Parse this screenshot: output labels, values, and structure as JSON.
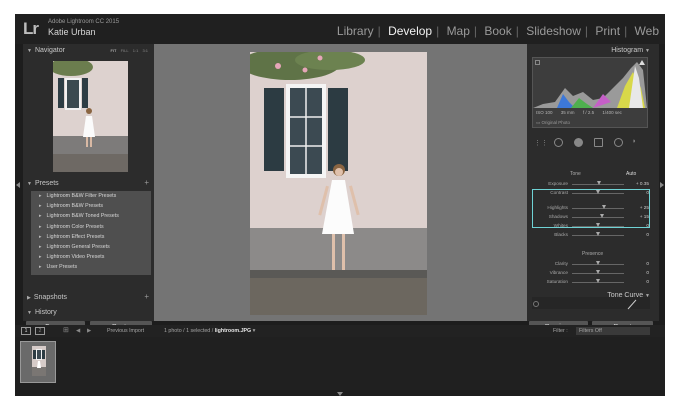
{
  "app": {
    "logo": "Lr",
    "product": "Adobe Lightroom CC 2015",
    "user": "Katie Urban"
  },
  "modules": [
    {
      "label": "Library",
      "active": false
    },
    {
      "label": "Develop",
      "active": true
    },
    {
      "label": "Map",
      "active": false
    },
    {
      "label": "Book",
      "active": false
    },
    {
      "label": "Slideshow",
      "active": false
    },
    {
      "label": "Print",
      "active": false
    },
    {
      "label": "Web",
      "active": false
    }
  ],
  "left_panel": {
    "navigator": {
      "title": "Navigator",
      "zoom_options": [
        "FIT",
        "FILL",
        "1:1",
        "3:1"
      ],
      "selected_zoom": "FIT"
    },
    "presets": {
      "title": "Presets",
      "items": [
        "Lightroom B&W Filter Presets",
        "Lightroom B&W Presets",
        "Lightroom B&W Toned Presets",
        "Lightroom Color Presets",
        "Lightroom Effect Presets",
        "Lightroom General Presets",
        "Lightroom Video Presets",
        "User Presets"
      ]
    },
    "snapshots": {
      "title": "Snapshots"
    },
    "history": {
      "title": "History"
    },
    "copy_label": "Copy...",
    "paste_label": "Paste"
  },
  "right_panel": {
    "histogram": {
      "title": "Histogram",
      "iso": "ISO 100",
      "focal": "35 mm",
      "aperture": "f / 2.5",
      "shutter": "1/400 sec",
      "original_label": "Original Photo"
    },
    "tone": {
      "section_label": "Tone",
      "auto_label": "Auto",
      "sliders": [
        {
          "label": "Exposure",
          "value": "+ 0.35",
          "position": 0.52
        },
        {
          "label": "Contrast",
          "value": "0",
          "position": 0.5
        },
        {
          "label": "Highlights",
          "value": "+ 25",
          "position": 0.62
        },
        {
          "label": "Shadows",
          "value": "+ 15",
          "position": 0.57
        },
        {
          "label": "Whites",
          "value": "0",
          "position": 0.5
        },
        {
          "label": "Blacks",
          "value": "0",
          "position": 0.5
        }
      ]
    },
    "presence": {
      "section_label": "Presence",
      "sliders": [
        {
          "label": "Clarity",
          "value": "0",
          "position": 0.5
        },
        {
          "label": "Vibrance",
          "value": "0",
          "position": 0.5
        },
        {
          "label": "Saturation",
          "value": "0",
          "position": 0.5
        }
      ]
    },
    "tone_curve": {
      "title": "Tone Curve"
    },
    "previous_label": "Previous",
    "reset_label": "Reset"
  },
  "filmstrip": {
    "view1": "1",
    "view2": "2",
    "previous_import": "Previous Import",
    "photo_count": "1 photo / 1 selected /",
    "filename": "lightroom.JPG",
    "filter_label": "Filter :",
    "filter_value": "Filters Off"
  },
  "colors": {
    "highlight_box": "#6fd3d5",
    "panel": "#2c2c2c",
    "canvas": "#747474"
  }
}
